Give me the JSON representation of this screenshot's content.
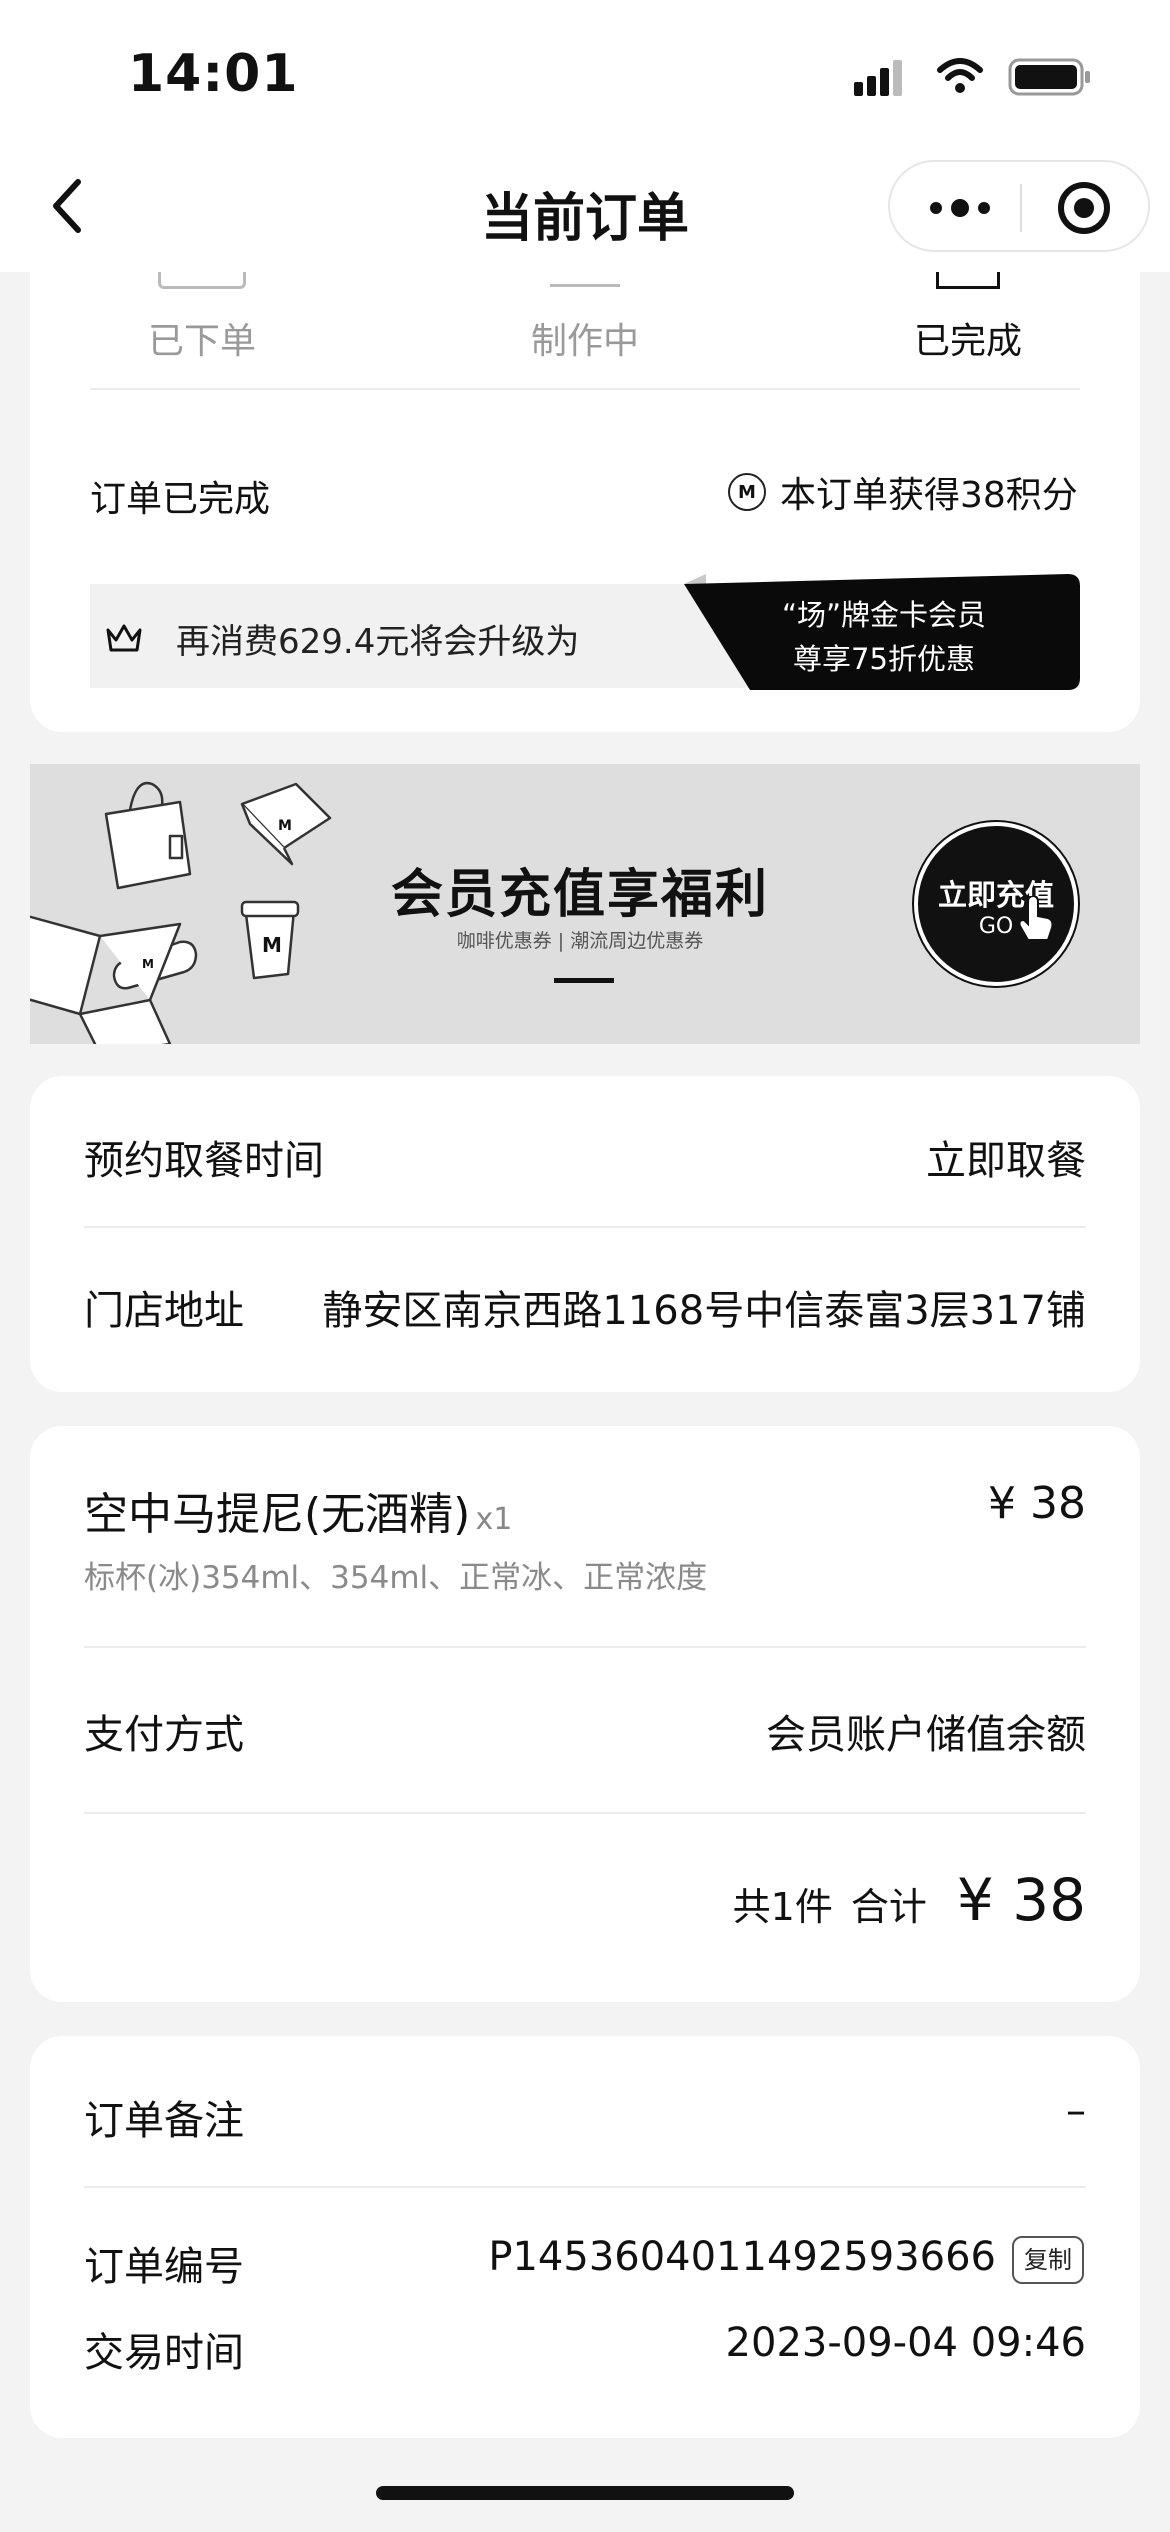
{
  "status_bar": {
    "time": "14:01"
  },
  "nav": {
    "title": "当前订单"
  },
  "progress": {
    "steps": [
      "已下单",
      "制作中",
      "已完成"
    ],
    "current_step": 3
  },
  "order_status": {
    "status": "订单已完成",
    "points": "本订单获得38积分"
  },
  "upgrade": {
    "text": "再消费629.4元将会升级为",
    "tag_line1": "“场”牌金卡会员",
    "tag_line2": "尊享75折优惠"
  },
  "banner": {
    "title": "会员充值享福利",
    "subtitle": "咖啡优惠券 | 潮流周边优惠券",
    "cta": "立即充值",
    "cta_sub": "GO"
  },
  "pickup": {
    "time_label": "预约取餐时间",
    "time_value": "立即取餐",
    "address_label": "门店地址",
    "address_value": "静安区南京西路1168号中信泰富3层317铺"
  },
  "item": {
    "name": "空中马提尼(无酒精)",
    "qty": "x1",
    "price": "¥ 38",
    "spec": "标杯(冰)354ml、354ml、正常冰、正常浓度"
  },
  "payment": {
    "label": "支付方式",
    "value": "会员账户储值余额",
    "count_label": "共1件",
    "total_label": "合计",
    "total_value": "¥ 38"
  },
  "info": {
    "remark_label": "订单备注",
    "remark_value": "–",
    "order_no_label": "订单编号",
    "order_no_value": "P1453604011492593666",
    "copy_label": "复制",
    "time_label": "交易时间",
    "time_value": "2023-09-04 09:46"
  },
  "colors": {
    "accent": "#111111",
    "background": "#f3f3f3",
    "card": "#ffffff",
    "muted": "#9a9a9a"
  }
}
